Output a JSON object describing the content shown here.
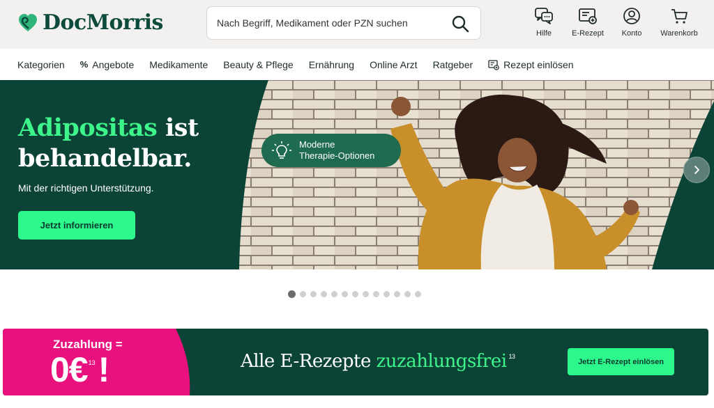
{
  "header": {
    "brand": "DocMorris",
    "search": {
      "placeholder": "Nach Begriff, Medikament oder PZN suchen"
    },
    "actions": [
      {
        "label": "Hilfe",
        "icon": "help-chat-icon"
      },
      {
        "label": "E-Rezept",
        "icon": "e-prescription-icon"
      },
      {
        "label": "Konto",
        "icon": "account-icon"
      },
      {
        "label": "Warenkorb",
        "icon": "cart-icon"
      }
    ]
  },
  "nav": {
    "items": [
      {
        "label": "Kategorien"
      },
      {
        "label": "Angebote",
        "prefix": "%"
      },
      {
        "label": "Medikamente"
      },
      {
        "label": "Beauty & Pflege"
      },
      {
        "label": "Ernährung"
      },
      {
        "label": "Online Arzt"
      },
      {
        "label": "Ratgeber"
      },
      {
        "label": "Rezept einlösen",
        "icon": "prescription-icon"
      }
    ]
  },
  "hero": {
    "title_highlight": "Adipositas",
    "title_rest_1": " ist",
    "title_line_2": "behandelbar.",
    "subtitle": "Mit der richtigen Unterstützung.",
    "cta": "Jetzt informieren",
    "badge_line_1": "Moderne",
    "badge_line_2": "Therapie-Optionen",
    "slide_count": 13,
    "active_slide": 0
  },
  "promo": {
    "label": "Zuzahlung =",
    "amount": "0€",
    "amount_sup": "13",
    "amount_suffix": "!",
    "headline_plain": "Alle E-Rezepte ",
    "headline_highlight": "zuzahlungsfrei",
    "headline_sup": "13",
    "cta": "Jetzt E-Rezept einlösen"
  },
  "colors": {
    "brand_dark_green": "#0b4436",
    "accent_green": "#2cf88c",
    "highlight_green": "#3df58b",
    "promo_pink": "#e8117d",
    "header_bg": "#f3f1ef"
  }
}
